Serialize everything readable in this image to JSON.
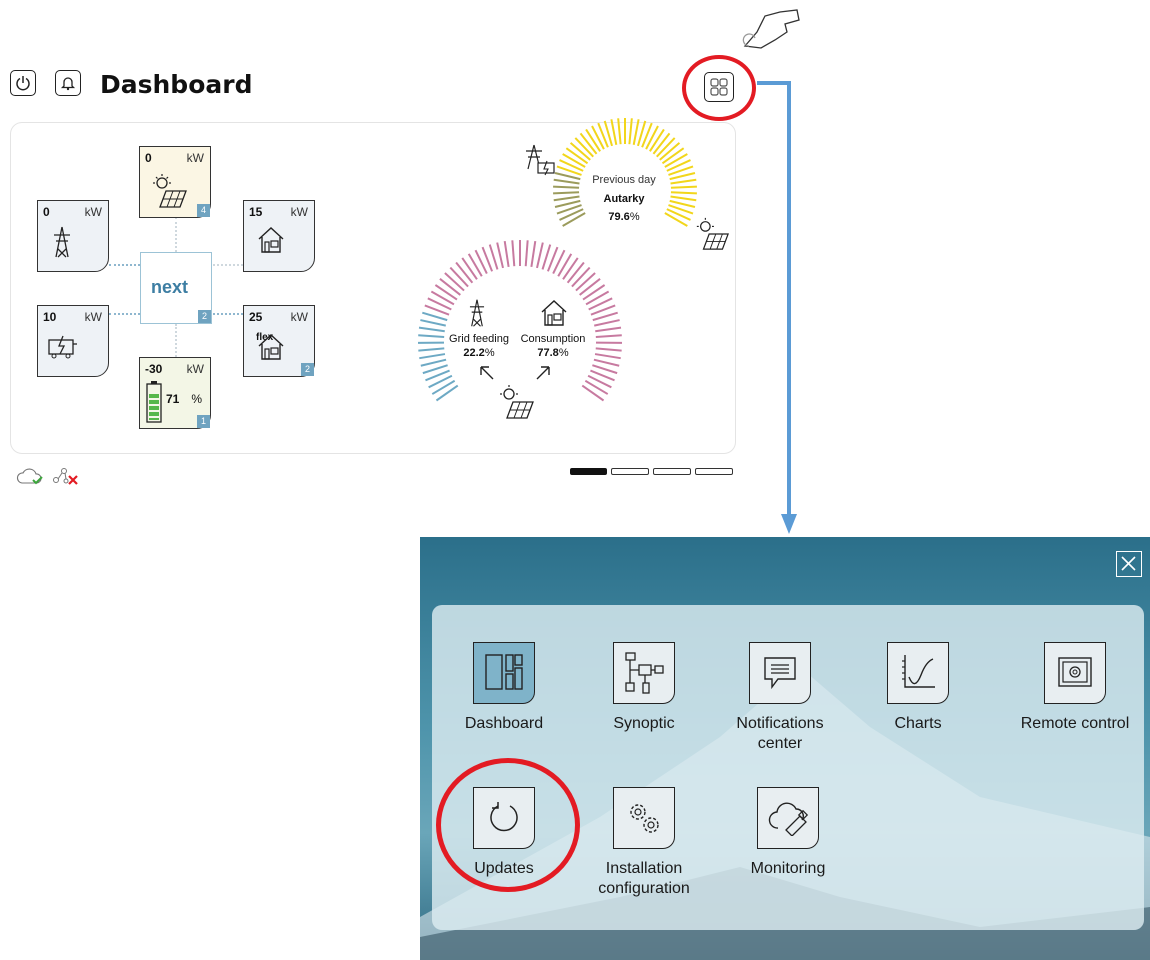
{
  "header": {
    "title": "Dashboard",
    "power_icon": "power-icon",
    "bell_icon": "bell-icon",
    "menu_icon": "grid-menu-icon"
  },
  "tiles": {
    "grid": {
      "value": "0",
      "unit": "kW"
    },
    "solar": {
      "value": "0",
      "unit": "kW",
      "badge": "4"
    },
    "house": {
      "value": "15",
      "unit": "kW"
    },
    "generator": {
      "value": "10",
      "unit": "kW"
    },
    "next": {
      "logo": "next",
      "badge": "2"
    },
    "flex": {
      "value": "25",
      "unit": "kW",
      "label": "flex",
      "badge": "2"
    },
    "battery": {
      "value": "-30",
      "unit": "kW",
      "soc": "71",
      "soc_unit": "%",
      "badge": "1"
    }
  },
  "autarky": {
    "caption": "Previous day",
    "label": "Autarky",
    "value": "79.6",
    "unit": "%"
  },
  "distribution": {
    "grid_feeding_label": "Grid feeding",
    "grid_feeding_value": "22.2",
    "grid_feeding_unit": "%",
    "consumption_label": "Consumption",
    "consumption_value": "77.8",
    "consumption_unit": "%"
  },
  "status": {
    "cloud": "cloud-ok-icon",
    "network": "network-error-icon"
  },
  "pager": {
    "pages": 4,
    "active": 1
  },
  "menu": {
    "close_icon": "close-icon",
    "items": [
      {
        "label": "Dashboard",
        "icon": "dashboard-icon"
      },
      {
        "label": "Synoptic",
        "icon": "synoptic-icon"
      },
      {
        "label": "Notifications center",
        "icon": "notifications-icon"
      },
      {
        "label": "Charts",
        "icon": "charts-icon"
      },
      {
        "label": "Remote control",
        "icon": "remote-control-icon"
      },
      {
        "label": "Updates",
        "icon": "updates-icon"
      },
      {
        "label": "Installation configuration",
        "icon": "installation-config-icon"
      },
      {
        "label": "Monitoring",
        "icon": "monitoring-icon"
      }
    ]
  },
  "colors": {
    "accent": "#6fa3c0",
    "highlight": "#e31b23",
    "arrow": "#5b9bd5",
    "autarky": "#f2d61b",
    "consumption": "#c77aa0",
    "grid": "#6da9c4"
  }
}
